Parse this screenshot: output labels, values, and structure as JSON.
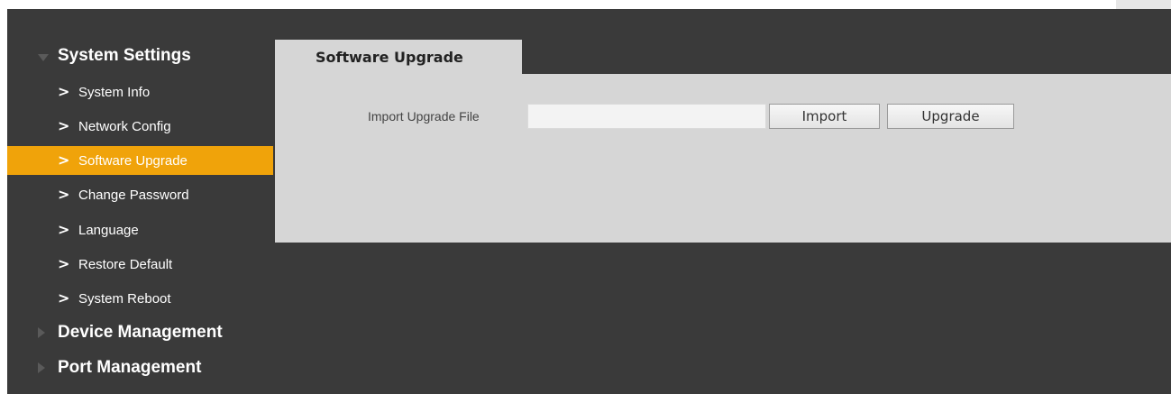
{
  "sidebar": {
    "groups": [
      {
        "label": "System Settings",
        "expanded": true,
        "items": [
          {
            "label": "System Info"
          },
          {
            "label": "Network Config"
          },
          {
            "label": "Software Upgrade",
            "active": true
          },
          {
            "label": "Change Password"
          },
          {
            "label": "Language"
          },
          {
            "label": "Restore Default"
          },
          {
            "label": "System Reboot"
          }
        ]
      },
      {
        "label": "Device Management",
        "expanded": false
      },
      {
        "label": "Port Management",
        "expanded": false
      }
    ],
    "chevron_glyph": ">",
    "active_color": "#f0a30a"
  },
  "main": {
    "tab_label": "Software Upgrade",
    "form": {
      "import_label": "Import Upgrade File",
      "file_value": "",
      "import_button": "Import",
      "upgrade_button": "Upgrade"
    }
  },
  "colors": {
    "background": "#3a3a3a",
    "panel": "#d6d6d6"
  }
}
